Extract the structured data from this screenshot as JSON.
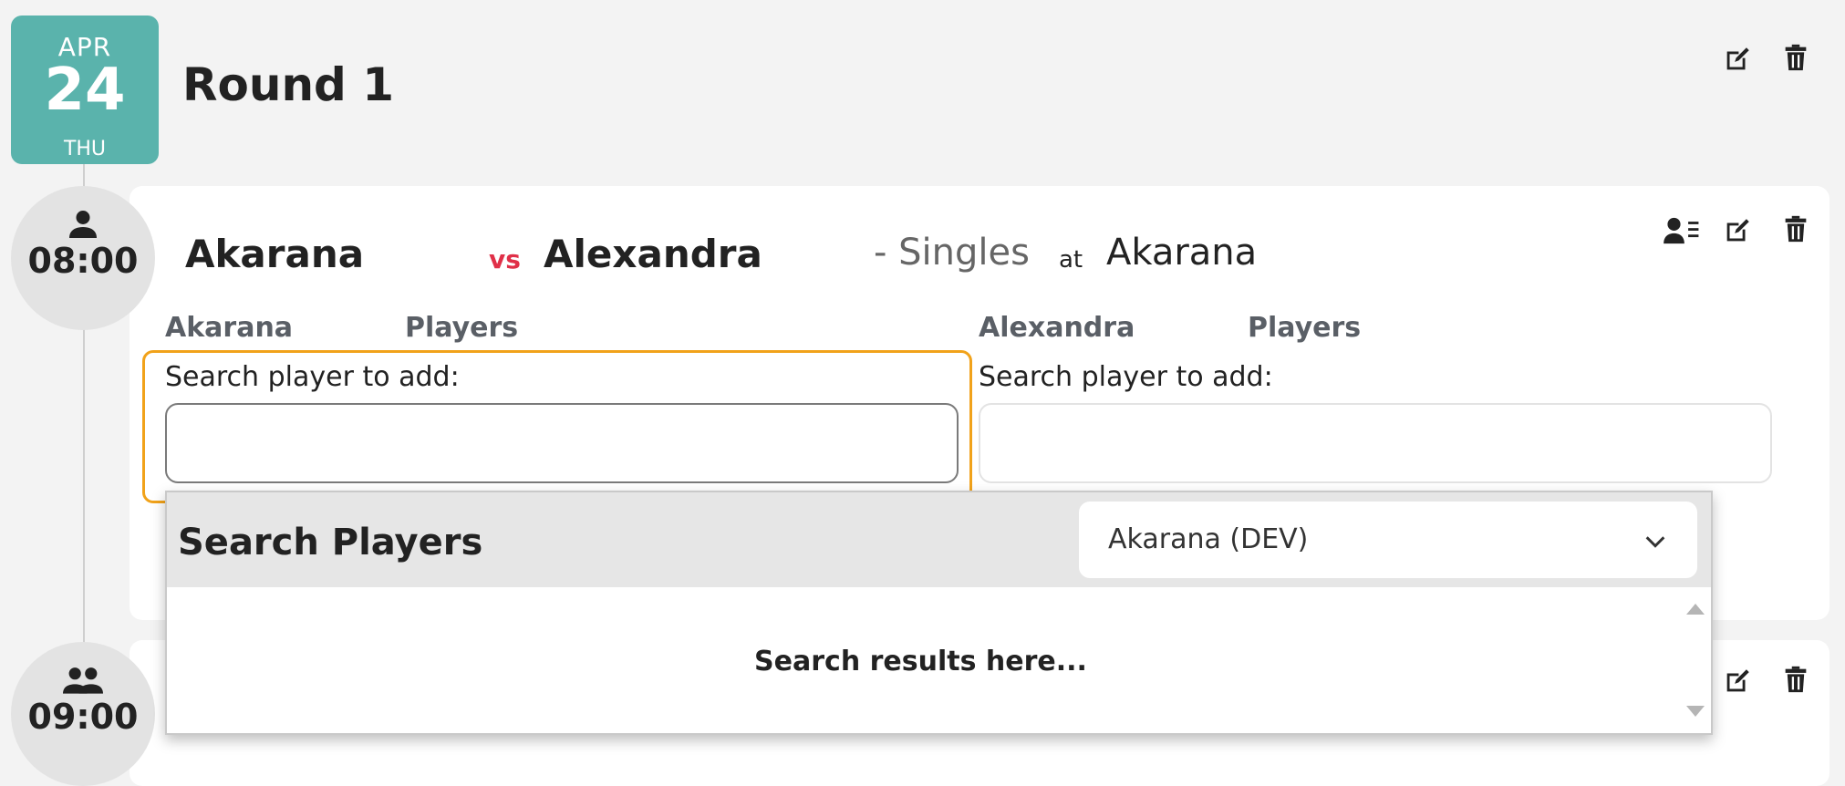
{
  "round": {
    "date": {
      "month": "APR",
      "day": "24",
      "weekday": "THU"
    },
    "title": "Round 1",
    "actions": {
      "edit_icon": "edit-icon",
      "delete_icon": "trash-icon"
    }
  },
  "matches": [
    {
      "time": "08:00",
      "type_icon": "single-person-icon",
      "home_team": "Akarana",
      "vs_label": "vs",
      "away_team": "Alexandra",
      "format": "- Singles",
      "at_label": "at",
      "venue": "Akarana",
      "actions": {
        "players_icon": "player-list-icon",
        "edit_icon": "edit-icon",
        "delete_icon": "trash-icon"
      },
      "home_players": {
        "team": "Akarana",
        "heading": "Players",
        "search_label": "Search player to add:",
        "search_value": ""
      },
      "away_players": {
        "team": "Alexandra",
        "heading": "Players",
        "search_label": "Search player to add:",
        "search_value": ""
      }
    },
    {
      "time": "09:00",
      "type_icon": "group-people-icon",
      "actions": {
        "edit_icon": "edit-icon",
        "delete_icon": "trash-icon"
      }
    }
  ],
  "search_panel": {
    "title": "Search Players",
    "org_select": {
      "selected": "Akarana (DEV)"
    },
    "results_placeholder": "Search results here..."
  },
  "colors": {
    "date_badge": "#5ab3ac",
    "vs": "#e03048",
    "focus_ring": "#f1a21a"
  }
}
